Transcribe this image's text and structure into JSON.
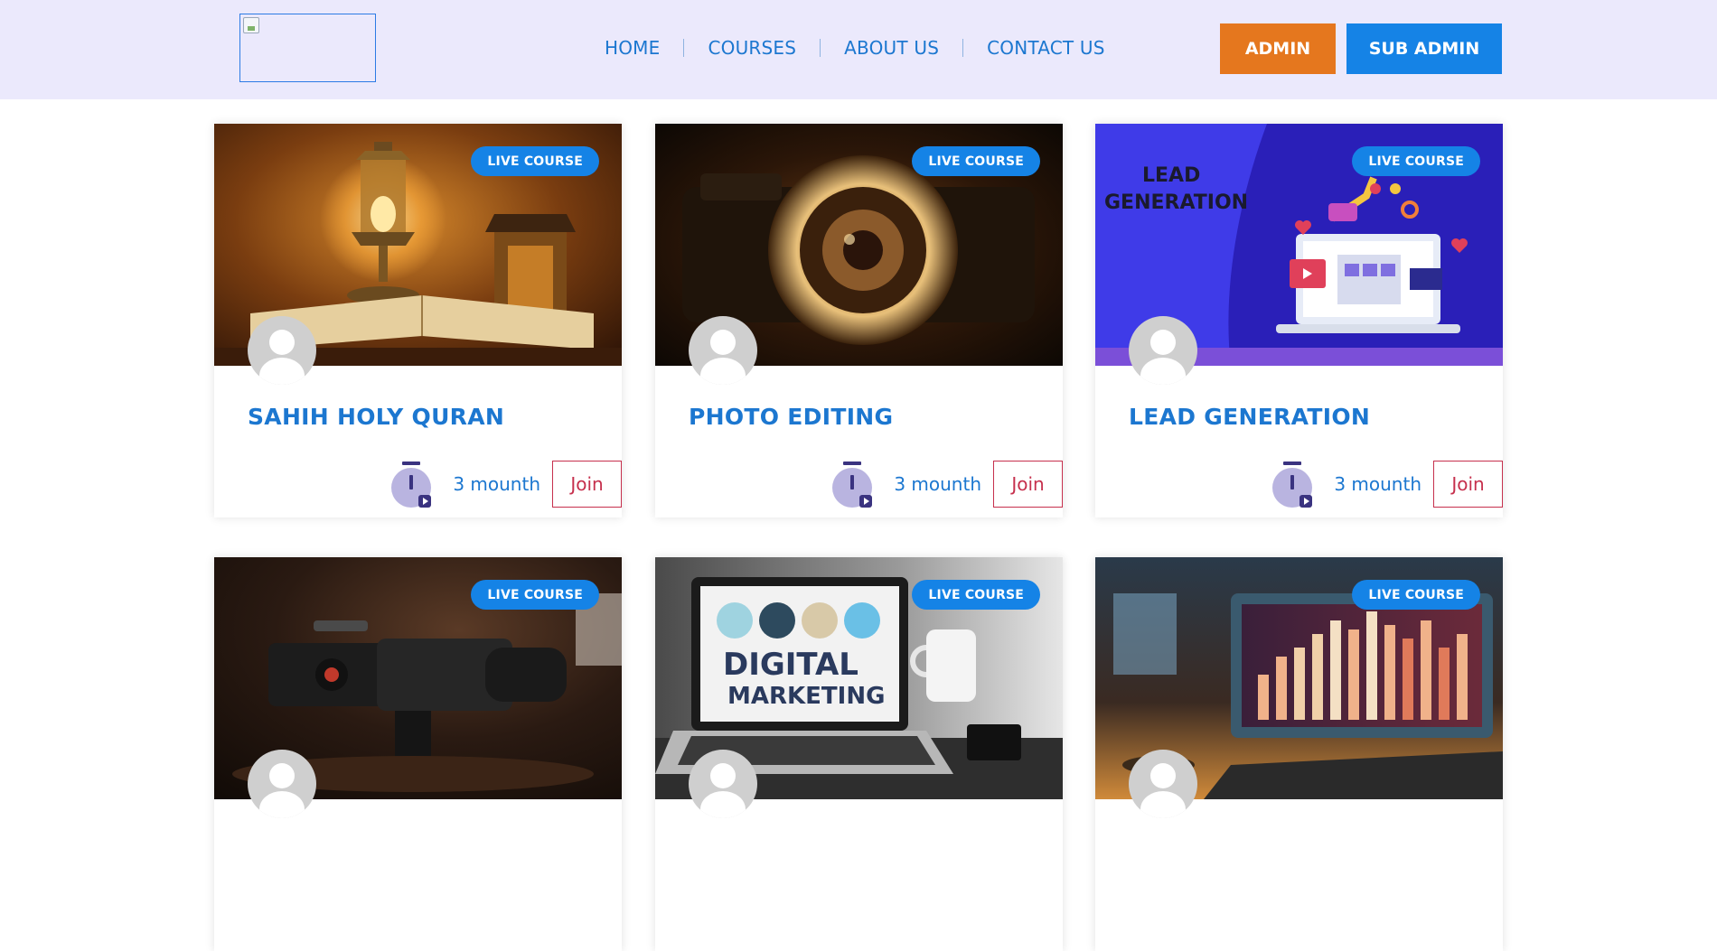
{
  "header": {
    "nav": [
      "HOME",
      "COURSES",
      "ABOUT US",
      "CONTACT US"
    ],
    "admin_label": "ADMIN",
    "subadmin_label": "SUB ADMIN"
  },
  "colors": {
    "header_bg": "#ebe9fc",
    "brand_blue": "#1583e6",
    "admin_orange": "#e5771e",
    "join_red": "#c6304d"
  },
  "cards": [
    {
      "badge": "LIVE COURSE",
      "title": "SAHIH HOLY QURAN",
      "duration": "3 mounth",
      "join": "Join",
      "image": "lanterns-and-open-book"
    },
    {
      "badge": "LIVE COURSE",
      "title": "PHOTO EDITING",
      "duration": "3 mounth",
      "join": "Join",
      "image": "camera-lens"
    },
    {
      "badge": "LIVE COURSE",
      "title": "LEAD GENERATION",
      "duration": "3 mounth",
      "join": "Join",
      "image": "lead-generation-illustration",
      "image_text": [
        "LEAD",
        "GENERATION"
      ]
    },
    {
      "badge": "LIVE COURSE",
      "image": "video-camera"
    },
    {
      "badge": "LIVE COURSE",
      "image": "digital-marketing-laptop",
      "image_text": [
        "DIGITAL",
        "MARKETING"
      ]
    },
    {
      "badge": "LIVE COURSE",
      "image": "monitor-with-charts"
    }
  ]
}
